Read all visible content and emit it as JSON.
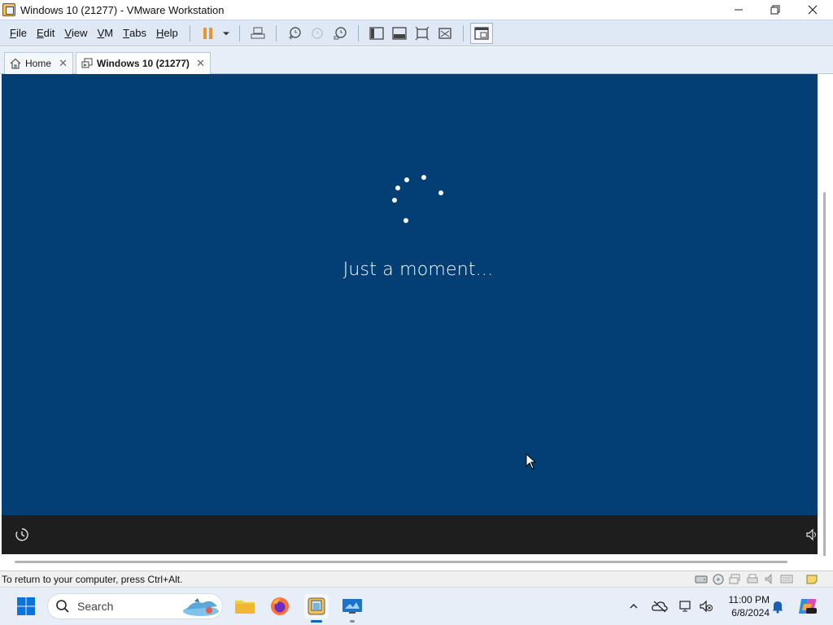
{
  "window": {
    "title": "Windows 10 (21277) - VMware Workstation",
    "minimize": "—",
    "maximize": "❐",
    "close": "✕"
  },
  "menu": {
    "items": [
      {
        "label_first": "F",
        "label_rest": "ile"
      },
      {
        "label_first": "E",
        "label_rest": "dit"
      },
      {
        "label_first": "V",
        "label_rest": "iew"
      },
      {
        "label_first": "V",
        "label_rest": "M"
      },
      {
        "label_first": "T",
        "label_rest": "abs"
      },
      {
        "label_first": "H",
        "label_rest": "elp"
      }
    ]
  },
  "tabs": {
    "home": {
      "label": "Home",
      "close": "✕"
    },
    "vm": {
      "label": "Windows 10 (21277)",
      "close": "✕"
    }
  },
  "vm": {
    "message": "Just a moment...",
    "background_color": "#033f74"
  },
  "statusbar": {
    "text": "To return to your computer, press Ctrl+Alt."
  },
  "taskbar": {
    "search_label": "Search",
    "time": "11:00 PM",
    "date": "6/8/2024"
  },
  "colors": {
    "accent": "#0067c0",
    "toolbar_bg": "#dfe9f5"
  }
}
